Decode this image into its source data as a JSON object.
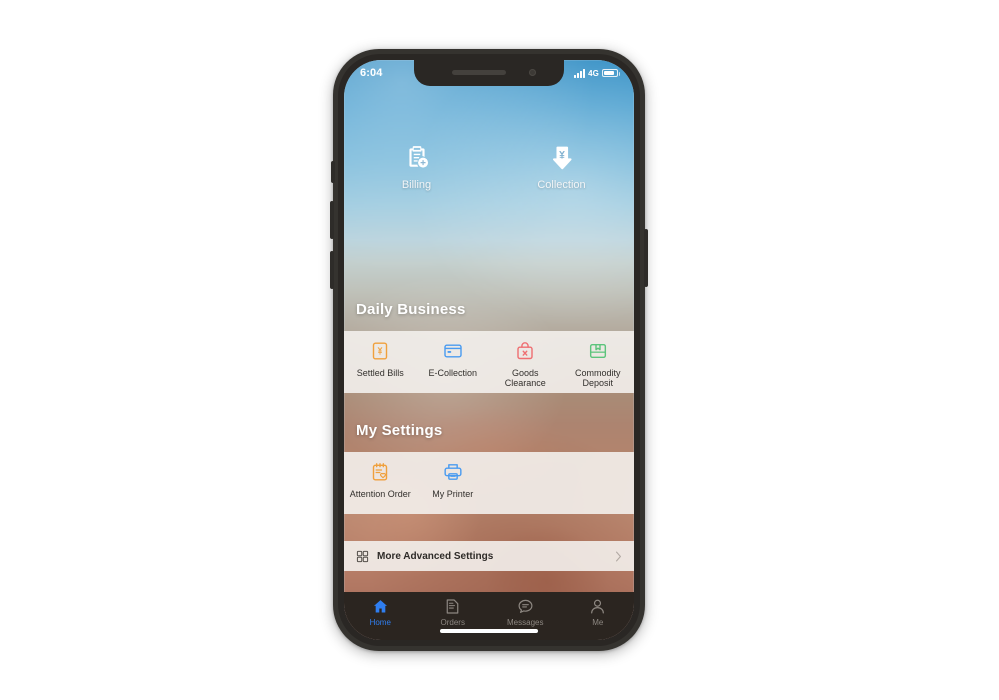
{
  "status_bar": {
    "time": "6:04",
    "network": "4G",
    "signal_icon": "signal-bars-icon",
    "battery_icon": "battery-icon"
  },
  "quick_actions": [
    {
      "label": "Billing",
      "icon": "clipboard-add-icon"
    },
    {
      "label": "Collection",
      "icon": "yen-arrow-down-icon"
    }
  ],
  "sections": [
    {
      "title": "Daily Business",
      "tiles": [
        {
          "label": "Settled Bills",
          "icon": "yen-box-icon",
          "color": "#f0a03c"
        },
        {
          "label": "E-Collection",
          "icon": "credit-card-icon",
          "color": "#4a9bf0"
        },
        {
          "label": "Goods Clearance",
          "icon": "bag-x-icon",
          "color": "#ef6f72"
        },
        {
          "label": "Commodity Deposit",
          "icon": "package-box-icon",
          "color": "#5cc47c"
        }
      ]
    },
    {
      "title": "My Settings",
      "tiles": [
        {
          "label": "Attention Order",
          "icon": "note-heart-icon",
          "color": "#f0a03c"
        },
        {
          "label": "My Printer",
          "icon": "printer-icon",
          "color": "#4a9bf0"
        }
      ]
    }
  ],
  "advanced_row": {
    "label": "More Advanced Settings",
    "icon": "grid-squares-icon",
    "chevron": "chevron-right-icon"
  },
  "tab_bar": {
    "items": [
      {
        "label": "Home",
        "icon": "home-icon",
        "active": true
      },
      {
        "label": "Orders",
        "icon": "document-icon",
        "active": false
      },
      {
        "label": "Messages",
        "icon": "chat-icon",
        "active": false
      },
      {
        "label": "Me",
        "icon": "person-icon",
        "active": false
      }
    ],
    "active_color": "#2f7ef0",
    "inactive_color": "#8d8781",
    "background": "#2b2520"
  },
  "theme": {
    "panel_bg": "#f3f0ec",
    "heading_color": "#ffffff",
    "wallpaper_top": "#3f95c8",
    "wallpaper_bottom": "#a56c59"
  }
}
